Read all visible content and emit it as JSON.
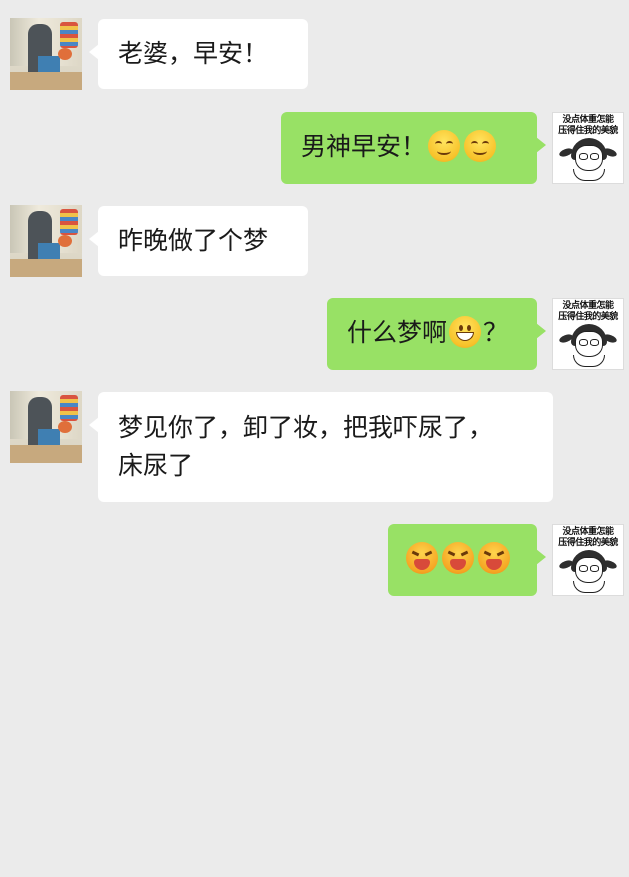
{
  "messages": [
    {
      "side": "left",
      "text": "老婆，早安！"
    },
    {
      "side": "right",
      "text": "男神早安！",
      "emojis": [
        "smile-icon",
        "smile-icon"
      ]
    },
    {
      "side": "left",
      "text": "昨晚做了个梦"
    },
    {
      "side": "right",
      "text_before": "什么梦啊",
      "text_after": "？",
      "emojis": [
        "grin-icon"
      ]
    },
    {
      "side": "left",
      "line1": "梦见你了，卸了妆，把我吓尿了，",
      "line2": "床尿了"
    },
    {
      "side": "right",
      "emojis": [
        "tongue-face-icon",
        "tongue-face-icon",
        "tongue-face-icon"
      ]
    }
  ],
  "avatars": {
    "right_caption_line1": "没点体重怎能",
    "right_caption_line2": "压得住我的美貌"
  },
  "colors": {
    "background": "#ebebeb",
    "incoming_bubble": "#ffffff",
    "outgoing_bubble": "#98e165"
  }
}
